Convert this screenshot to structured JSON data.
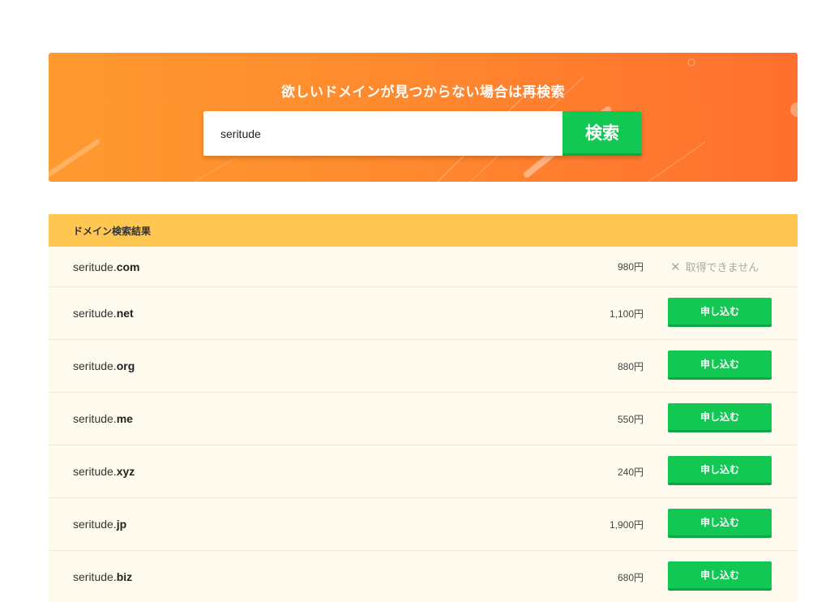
{
  "hero": {
    "title": "欲しいドメインが見つからない場合は再検索",
    "search_value": "seritude",
    "search_button": "検索"
  },
  "results": {
    "header": "ドメイン検索結果",
    "rows": [
      {
        "name": "seritude.",
        "tld": "com",
        "price": "980円",
        "available": false,
        "status": "取得できません"
      },
      {
        "name": "seritude.",
        "tld": "net",
        "price": "1,100円",
        "available": true,
        "action": "申し込む"
      },
      {
        "name": "seritude.",
        "tld": "org",
        "price": "880円",
        "available": true,
        "action": "申し込む"
      },
      {
        "name": "seritude.",
        "tld": "me",
        "price": "550円",
        "available": true,
        "action": "申し込む"
      },
      {
        "name": "seritude.",
        "tld": "xyz",
        "price": "240円",
        "available": true,
        "action": "申し込む"
      },
      {
        "name": "seritude.",
        "tld": "jp",
        "price": "1,900円",
        "available": true,
        "action": "申し込む"
      },
      {
        "name": "seritude.",
        "tld": "biz",
        "price": "680円",
        "available": true,
        "action": "申し込む"
      }
    ]
  },
  "colors": {
    "hero_start": "#ff9a30",
    "hero_end": "#ff6f2f",
    "green": "#13c753",
    "header_yellow": "#ffc752",
    "row_bg": "#fefbee"
  },
  "icons": {
    "unavailable": "close-icon"
  }
}
